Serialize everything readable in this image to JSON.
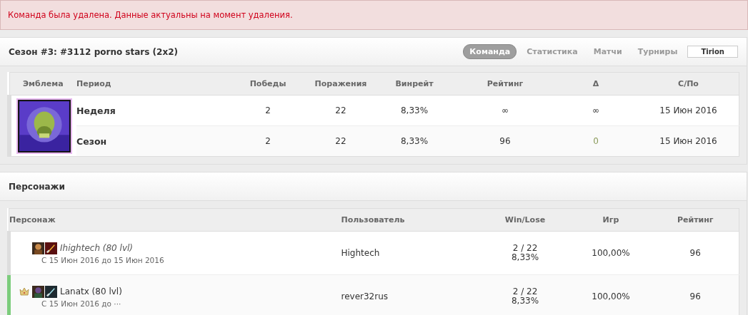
{
  "alert": {
    "text": "Команда была удалена. Данные актуальны на момент удаления."
  },
  "season": {
    "title": "Сезон #3: #3112 porno stars (2x2)",
    "tabs": [
      {
        "label": "Команда",
        "selected": true
      },
      {
        "label": "Статистика",
        "selected": false
      },
      {
        "label": "Матчи",
        "selected": false
      },
      {
        "label": "Турниры",
        "selected": false
      }
    ],
    "realm": "Tirion",
    "table": {
      "columns": [
        "Эмблема",
        "Период",
        "Победы",
        "Поражения",
        "Винрейт",
        "Рейтинг",
        "Δ",
        "С/По"
      ],
      "rows": [
        {
          "period": "Неделя",
          "wins": "2",
          "losses": "22",
          "winrate": "8,33%",
          "rating": "∞",
          "delta": "∞",
          "delta_neutral": false,
          "date": "15 Июн 2016"
        },
        {
          "period": "Сезон",
          "wins": "2",
          "losses": "22",
          "winrate": "8,33%",
          "rating": "96",
          "delta": "0",
          "delta_neutral": true,
          "date": "15 Июн 2016"
        }
      ]
    }
  },
  "characters": {
    "title": "Персонажи",
    "columns": [
      "Персонаж",
      "Пользователь",
      "Win/Lose",
      "Игр",
      "Рейтинг"
    ],
    "rows": [
      {
        "name": "Ihightech (80 lvl)",
        "active": false,
        "captain": false,
        "period": "С 15 Июн 2016 до 15 Июн 2016",
        "user": "Hightech",
        "win_lose": "2 / 22",
        "winrate": "8,33%",
        "games": "100,00%",
        "rating": "96"
      },
      {
        "name": "Lanatx (80 lvl)",
        "active": true,
        "captain": true,
        "period": "С 15 Июн 2016 до ···",
        "user": "rever32rus",
        "win_lose": "2 / 22",
        "winrate": "8,33%",
        "games": "100,00%",
        "rating": "96"
      }
    ]
  }
}
